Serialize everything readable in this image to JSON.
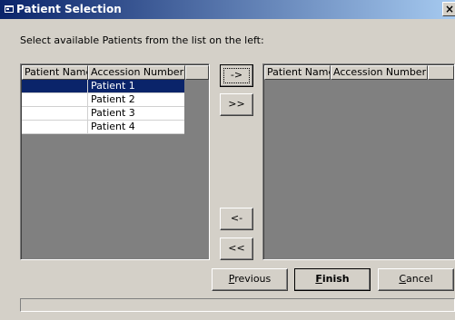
{
  "window": {
    "title": "Patient Selection",
    "close_glyph": "×"
  },
  "instruction": "Select available Patients from the list on the left:",
  "left_list": {
    "columns": [
      "Patient Name",
      "Accession Number"
    ],
    "rows": [
      {
        "patient_name": "",
        "accession_number": "Patient 1",
        "selected": true
      },
      {
        "patient_name": "",
        "accession_number": "Patient 2",
        "selected": false
      },
      {
        "patient_name": "",
        "accession_number": "Patient 3",
        "selected": false
      },
      {
        "patient_name": "",
        "accession_number": "Patient 4",
        "selected": false
      }
    ]
  },
  "right_list": {
    "columns": [
      "Patient Name",
      "Accession Number"
    ],
    "rows": []
  },
  "transfer_buttons": {
    "move_right": "->",
    "move_all_right": ">>",
    "move_left": "<-",
    "move_all_left": "<<"
  },
  "footer": {
    "previous_label": "Previous",
    "previous_mnemonic_index": 0,
    "finish_label": "Finish",
    "finish_mnemonic_index": 0,
    "cancel_label": "Cancel",
    "cancel_mnemonic_index": 0
  },
  "colors": {
    "window_bg": "#d4d0c8",
    "titlebar_start": "#0a246a",
    "titlebar_end": "#a6caf0",
    "selection": "#0a246a",
    "list_bg": "#808080"
  }
}
